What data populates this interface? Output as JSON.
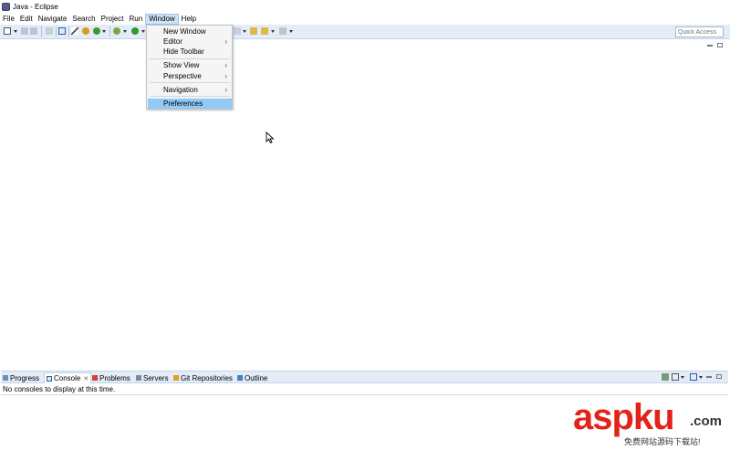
{
  "window": {
    "title": "Java - Eclipse"
  },
  "menubar": {
    "items": [
      {
        "label": "File",
        "active": false
      },
      {
        "label": "Edit",
        "active": false
      },
      {
        "label": "Navigate",
        "active": false
      },
      {
        "label": "Search",
        "active": false
      },
      {
        "label": "Project",
        "active": false
      },
      {
        "label": "Run",
        "active": false
      },
      {
        "label": "Window",
        "active": true
      },
      {
        "label": "Help",
        "active": false
      }
    ]
  },
  "window_menu": {
    "items": [
      {
        "label": "New Window",
        "has_submenu": false
      },
      {
        "label": "Editor",
        "has_submenu": true
      },
      {
        "label": "Hide Toolbar",
        "has_submenu": false
      },
      {
        "label": "Show View",
        "has_submenu": true
      },
      {
        "label": "Perspective",
        "has_submenu": true
      },
      {
        "label": "Navigation",
        "has_submenu": true
      },
      {
        "label": "Preferences",
        "has_submenu": false,
        "selected": true
      }
    ],
    "submenu_glyph": "›"
  },
  "toolbar": {
    "quick_access_placeholder": "Quick Access"
  },
  "bottom_panel": {
    "tabs": [
      {
        "label": "Progress",
        "icon": "progress-icon"
      },
      {
        "label": "Console",
        "icon": "console-icon",
        "active": true
      },
      {
        "label": "Problems",
        "icon": "problems-icon"
      },
      {
        "label": "Servers",
        "icon": "servers-icon"
      },
      {
        "label": "Git Repositories",
        "icon": "git-icon"
      },
      {
        "label": "Outline",
        "icon": "outline-icon"
      }
    ],
    "close_glyph": "✕",
    "console_message": "No consoles to display at this time."
  },
  "watermark": {
    "main": "aspku",
    "suffix": ".com",
    "subtitle": "免费网站源码下载站!"
  },
  "colors": {
    "toolbar_bg": "#e3ecf7",
    "menu_selected": "#91c9f7",
    "watermark_red": "#e2231a"
  }
}
